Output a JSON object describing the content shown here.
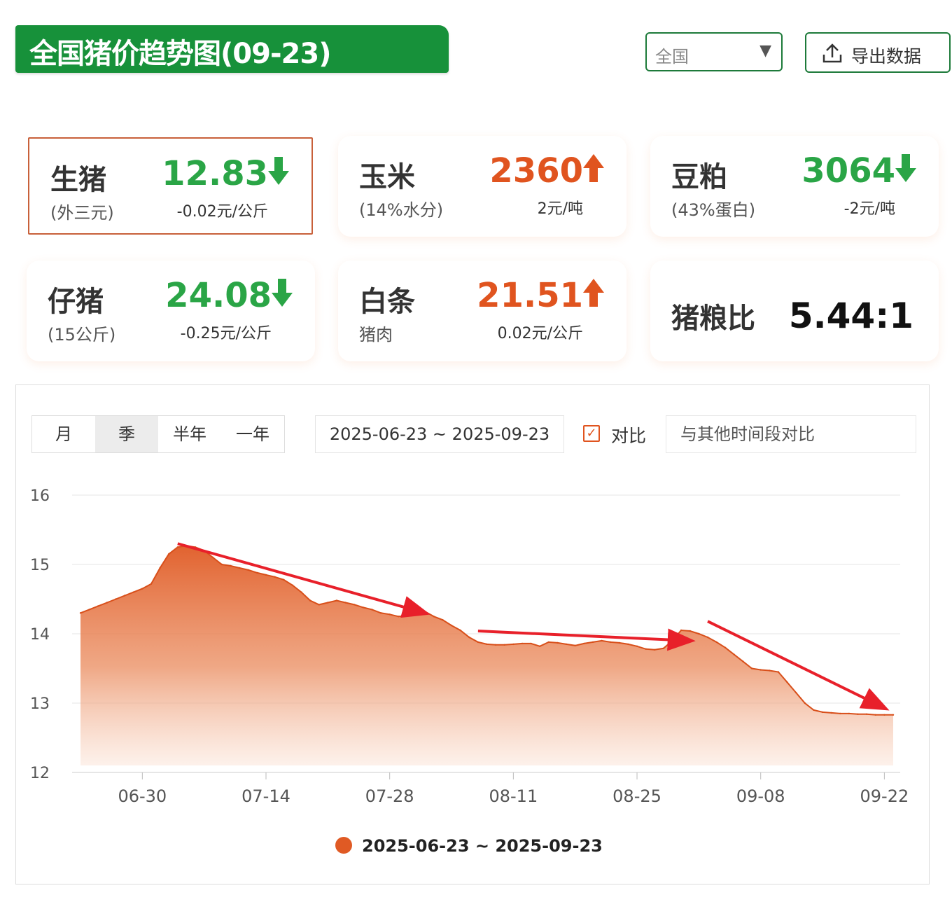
{
  "header": {
    "title": "全国猪价趋势图(09-23)",
    "region_select": {
      "value": "全国"
    },
    "export_label": "导出数据"
  },
  "cards": [
    {
      "name": "生猪",
      "sub": "(外三元)",
      "price": "12.83",
      "trend": "down",
      "change": "-0.02元/公斤"
    },
    {
      "name": "玉米",
      "sub": "(14%水分)",
      "price": "2360",
      "trend": "up",
      "change": "2元/吨"
    },
    {
      "name": "豆粕",
      "sub": "(43%蛋白)",
      "price": "3064",
      "trend": "down",
      "change": "-2元/吨"
    },
    {
      "name": "仔猪",
      "sub": "(15公斤)",
      "price": "24.08",
      "trend": "down",
      "change": "-0.25元/公斤"
    },
    {
      "name": "白条",
      "sub": "猪肉",
      "price": "21.51",
      "trend": "up",
      "change": "0.02元/公斤"
    },
    {
      "name": "猪粮比",
      "sub": "",
      "price": "5.44:1",
      "trend": "none",
      "change": ""
    }
  ],
  "colors": {
    "up": "#e0541f",
    "down": "#2aa546",
    "brand": "#17913a",
    "series": "#e05a24",
    "annotation": "#e8202a"
  },
  "controls": {
    "periods": [
      "月",
      "季",
      "半年",
      "一年"
    ],
    "active_period": "季",
    "date_range": "2025-06-23 ~ 2025-09-23",
    "compare_label": "对比",
    "compare_checked": true,
    "compare_placeholder": "与其他时间段对比"
  },
  "chart_data": {
    "type": "area",
    "xlabel": "",
    "ylabel": "",
    "ylim": [
      12,
      16
    ],
    "yticks": [
      12,
      13,
      14,
      15,
      16
    ],
    "xticks": [
      "06-30",
      "07-14",
      "07-28",
      "08-11",
      "08-25",
      "09-08",
      "09-22"
    ],
    "grid": true,
    "legend_position": "bottom",
    "series": [
      {
        "name": "2025-06-23 ~ 2025-09-23",
        "color": "#e05a24",
        "x": [
          "06-23",
          "06-24",
          "06-25",
          "06-26",
          "06-27",
          "06-28",
          "06-29",
          "06-30",
          "07-01",
          "07-02",
          "07-03",
          "07-04",
          "07-05",
          "07-06",
          "07-07",
          "07-08",
          "07-09",
          "07-10",
          "07-11",
          "07-12",
          "07-13",
          "07-14",
          "07-15",
          "07-16",
          "07-17",
          "07-18",
          "07-19",
          "07-20",
          "07-21",
          "07-22",
          "07-23",
          "07-24",
          "07-25",
          "07-26",
          "07-27",
          "07-28",
          "07-29",
          "07-30",
          "07-31",
          "08-01",
          "08-02",
          "08-03",
          "08-04",
          "08-05",
          "08-06",
          "08-07",
          "08-08",
          "08-09",
          "08-10",
          "08-11",
          "08-12",
          "08-13",
          "08-14",
          "08-15",
          "08-16",
          "08-17",
          "08-18",
          "08-19",
          "08-20",
          "08-21",
          "08-22",
          "08-23",
          "08-24",
          "08-25",
          "08-26",
          "08-27",
          "08-28",
          "08-29",
          "08-30",
          "08-31",
          "09-01",
          "09-02",
          "09-03",
          "09-04",
          "09-05",
          "09-06",
          "09-07",
          "09-08",
          "09-09",
          "09-10",
          "09-11",
          "09-12",
          "09-13",
          "09-14",
          "09-15",
          "09-16",
          "09-17",
          "09-18",
          "09-19",
          "09-20",
          "09-21",
          "09-22",
          "09-23"
        ],
        "values": [
          14.3,
          14.35,
          14.4,
          14.45,
          14.5,
          14.55,
          14.6,
          14.65,
          14.72,
          14.95,
          15.15,
          15.25,
          15.27,
          15.25,
          15.2,
          15.1,
          15.0,
          14.98,
          14.95,
          14.92,
          14.88,
          14.85,
          14.82,
          14.78,
          14.7,
          14.6,
          14.48,
          14.42,
          14.45,
          14.48,
          14.45,
          14.42,
          14.38,
          14.35,
          14.3,
          14.28,
          14.25,
          14.26,
          14.3,
          14.32,
          14.25,
          14.2,
          14.12,
          14.05,
          13.95,
          13.88,
          13.85,
          13.84,
          13.84,
          13.85,
          13.86,
          13.86,
          13.82,
          13.88,
          13.87,
          13.85,
          13.83,
          13.86,
          13.88,
          13.9,
          13.88,
          13.87,
          13.85,
          13.82,
          13.78,
          13.77,
          13.79,
          13.9,
          14.05,
          14.04,
          14.0,
          13.95,
          13.88,
          13.8,
          13.7,
          13.6,
          13.5,
          13.48,
          13.47,
          13.45,
          13.3,
          13.15,
          13.0,
          12.9,
          12.87,
          12.86,
          12.85,
          12.85,
          12.84,
          12.84,
          12.83,
          12.83,
          12.83
        ]
      }
    ],
    "annotations": [
      {
        "type": "arrow",
        "from": [
          "07-04",
          15.3
        ],
        "to": [
          "08-01",
          14.3
        ]
      },
      {
        "type": "arrow",
        "from": [
          "08-07",
          14.04
        ],
        "to": [
          "08-31",
          13.9
        ]
      },
      {
        "type": "arrow",
        "from": [
          "09-02",
          14.18
        ],
        "to": [
          "09-22",
          12.93
        ]
      }
    ]
  }
}
